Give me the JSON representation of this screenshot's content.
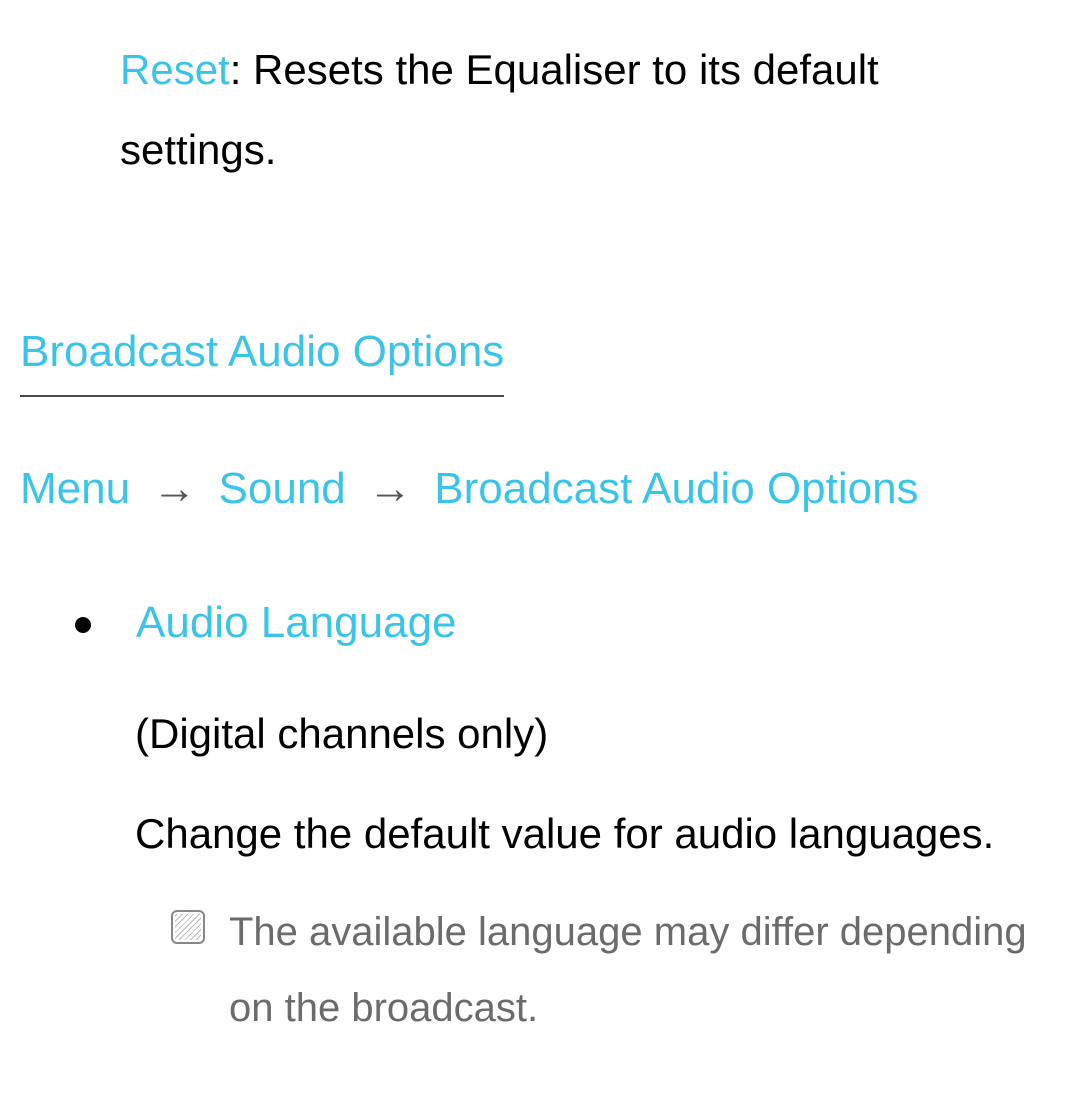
{
  "reset": {
    "label": "Reset",
    "description": ": Resets the Equaliser to its default settings."
  },
  "section_heading": "Broadcast Audio Options",
  "breadcrumb": {
    "item1": "Menu",
    "arrow": "→",
    "item2": "Sound",
    "item3": "Broadcast Audio Options"
  },
  "audio_language": {
    "title": "Audio Language",
    "qualifier": "(Digital channels only)",
    "description": "Change the default value for audio languages.",
    "note": "The available language may differ depending on the broadcast."
  }
}
